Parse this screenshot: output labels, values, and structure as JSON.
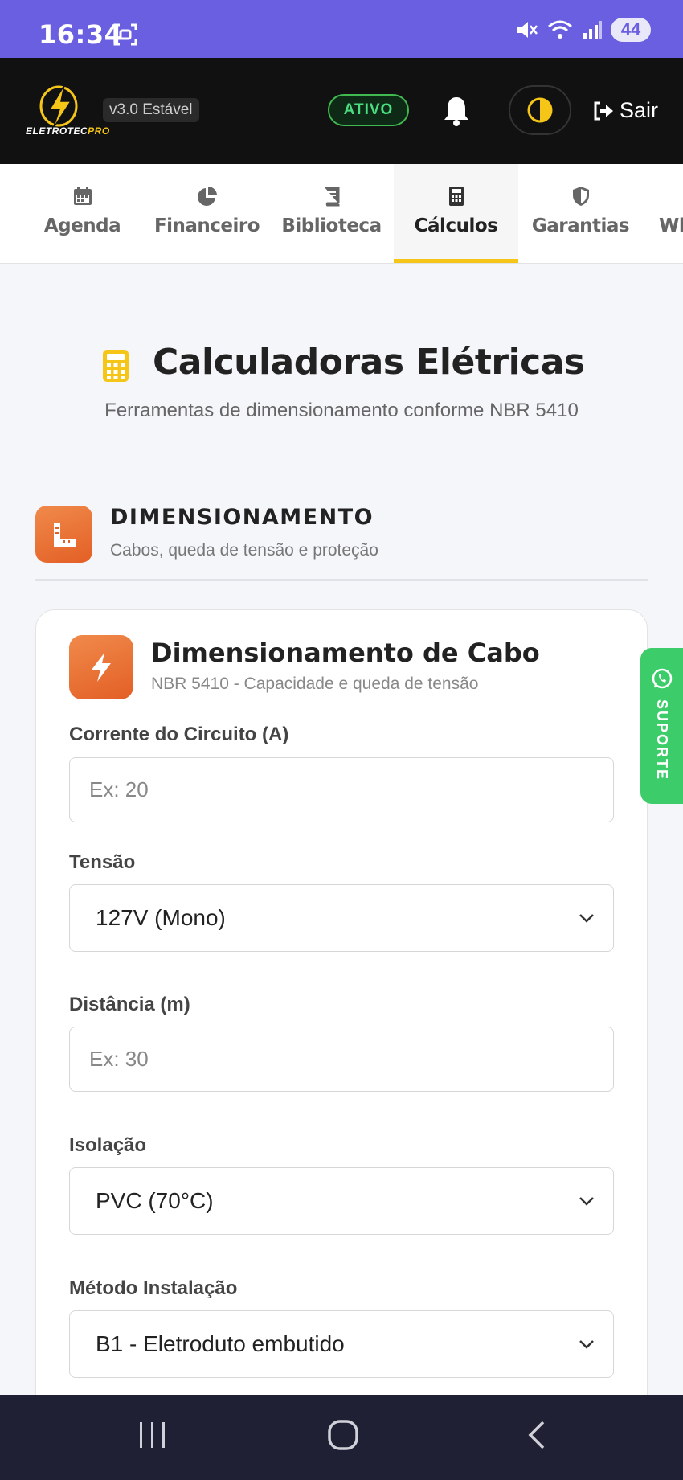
{
  "status_bar": {
    "time": "16:34",
    "battery": "44",
    "icons": [
      "screen-record-icon",
      "mute-icon",
      "wifi-icon",
      "signal-icon"
    ]
  },
  "header": {
    "logo_text_main": "ELETROTEC",
    "logo_text_pro": "PRO",
    "version": "v3.0 Estável",
    "status_badge": "ATIVO",
    "logout_label": "Sair",
    "colors": {
      "accent": "#f5c518",
      "status_green": "#3fb950"
    }
  },
  "nav": {
    "tabs": [
      {
        "label": "Agenda",
        "icon": "calendar-icon"
      },
      {
        "label": "Financeiro",
        "icon": "pie-chart-icon"
      },
      {
        "label": "Biblioteca",
        "icon": "book-icon"
      },
      {
        "label": "Cálculos",
        "icon": "calculator-icon",
        "active": true
      },
      {
        "label": "Garantias",
        "icon": "shield-icon"
      },
      {
        "label": "Wh"
      }
    ]
  },
  "page": {
    "title": "Calculadoras Elétricas",
    "subtitle": "Ferramentas de dimensionamento conforme NBR 5410"
  },
  "section": {
    "title": "DIMENSIONAMENTO",
    "subtitle": "Cabos, queda de tensão e proteção"
  },
  "card": {
    "title": "Dimensionamento de Cabo",
    "subtitle": "NBR 5410 - Capacidade e queda de tensão",
    "fields": {
      "corrente": {
        "label": "Corrente do Circuito (A)",
        "placeholder": "Ex: 20"
      },
      "tensao": {
        "label": "Tensão",
        "value": "127V (Mono)"
      },
      "distancia": {
        "label": "Distância (m)",
        "placeholder": "Ex: 30"
      },
      "isolacao": {
        "label": "Isolação",
        "value": "PVC (70°C)"
      },
      "metodo": {
        "label": "Método Instalação",
        "value": "B1 - Eletroduto embutido"
      }
    }
  },
  "support": {
    "label": "SUPORTE"
  }
}
